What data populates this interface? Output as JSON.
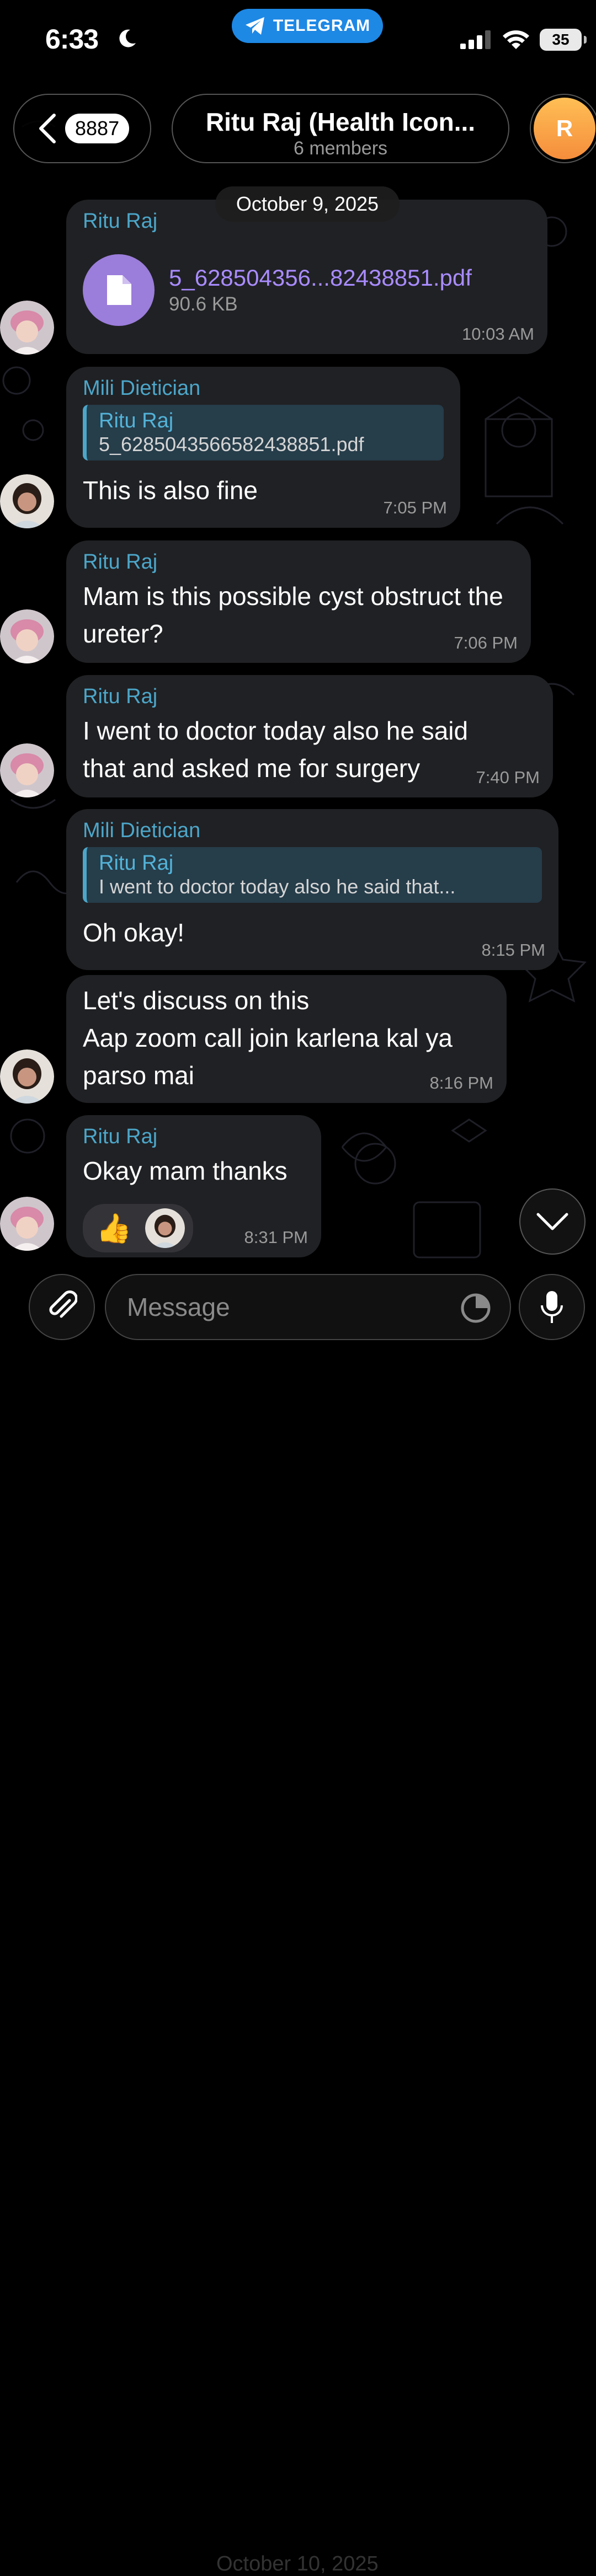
{
  "status": {
    "time": "6:33",
    "app_pill": "TELEGRAM",
    "battery": "35"
  },
  "header": {
    "back_count": "8887",
    "title": "Ritu Raj (Health Icon...",
    "subtitle": "6 members",
    "avatar_letter": "R"
  },
  "date_chip": "October 9, 2025",
  "messages": [
    {
      "sender": "Ritu Raj",
      "file_name": "5_628504356...82438851.pdf",
      "file_size": "90.6 KB",
      "time": "10:03 AM"
    },
    {
      "sender": "Mili Dietician",
      "reply_name": "Ritu Raj",
      "reply_text": "5_6285043566582438851.pdf",
      "text": "This is also fine",
      "time": "7:05 PM"
    },
    {
      "sender": "Ritu Raj",
      "text": "Mam is this possible cyst obstruct the ureter?",
      "time": "7:06 PM"
    },
    {
      "sender": "Ritu Raj",
      "text": "I went to doctor today also he said that and asked me for surgery",
      "time": "7:40 PM"
    },
    {
      "sender": "Mili Dietician",
      "reply_name": "Ritu Raj",
      "reply_text": "I went to doctor today also he said that...",
      "text": "Oh okay!",
      "time": "8:15 PM"
    },
    {
      "line1": "Let's discuss on this",
      "line2": "Aap zoom call join karlena kal ya",
      "line3": "parso mai",
      "time": "8:16 PM"
    },
    {
      "sender": "Ritu Raj",
      "text": "Okay mam thanks",
      "reaction": "👍",
      "time": "8:31 PM"
    }
  ],
  "composer": {
    "placeholder": "Message",
    "ghost_date": "October 10, 2025"
  },
  "colors": {
    "accent": "#4ca6c9",
    "bubble": "#202124",
    "file_icon": "#9b7ddb",
    "telegram_blue": "#1e88e5"
  },
  "icons": [
    "moon-icon",
    "telegram-plane-icon",
    "signal-icon",
    "wifi-icon",
    "back-chevron-icon",
    "file-icon",
    "chevron-down-icon",
    "paperclip-icon",
    "sticker-icon",
    "microphone-icon"
  ]
}
